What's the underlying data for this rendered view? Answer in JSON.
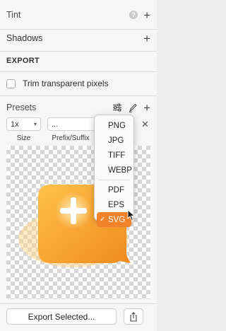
{
  "sections": {
    "tint_label": "Tint",
    "help_glyph": "?",
    "shadows_label": "Shadows",
    "export_label": "EXPORT",
    "trim_label": "Trim transparent pixels",
    "presets_label": "Presets"
  },
  "preset_row": {
    "scale_value": "1x",
    "suffix_value": "...",
    "size_caption": "Size",
    "suffix_caption": "Prefix/Suffix",
    "remove_glyph": "✕"
  },
  "format_menu": {
    "items_top": [
      "PNG",
      "JPG",
      "TIFF",
      "WEBP"
    ],
    "items_bottom": [
      "PDF",
      "EPS"
    ],
    "selected": "SVG",
    "check_glyph": "✓"
  },
  "bottom": {
    "export_button_label": "Export Selected..."
  },
  "colors": {
    "accent": "#f0832a",
    "icon_orange_light": "#ffc24a",
    "icon_orange_dark": "#f08a1c"
  },
  "icons": [
    "help-icon",
    "plus-icon",
    "sliders-icon",
    "pencil-icon",
    "chevron-down-icon",
    "close-icon",
    "checkmark-icon",
    "share-icon",
    "cursor-icon"
  ]
}
